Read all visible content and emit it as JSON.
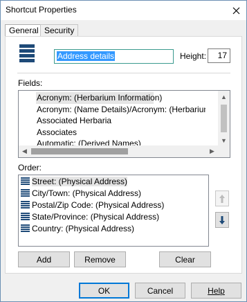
{
  "window": {
    "title": "Shortcut Properties"
  },
  "tabs": [
    {
      "label": "General"
    },
    {
      "label": "Security"
    }
  ],
  "general": {
    "name_value": "Address details",
    "height_label": "Height:",
    "height_value": "17"
  },
  "fields": {
    "label": "Fields:",
    "items": [
      "Acronym: (Herbarium Information)",
      "Acronym: (Name Details)/Acronym: (Herbarium In",
      "Associated Herbaria",
      "Associates",
      "Automatic: (Derived Names)"
    ]
  },
  "order": {
    "label": "Order:",
    "items": [
      "Street: (Physical Address)",
      "City/Town: (Physical Address)",
      "Postal/Zip Code: (Physical Address)",
      "State/Province: (Physical Address)",
      "Country: (Physical Address)"
    ]
  },
  "buttons": {
    "add": "Add",
    "remove": "Remove",
    "clear": "Clear",
    "ok": "OK",
    "cancel": "Cancel",
    "help": "Help"
  },
  "icons": {
    "close": "close-icon",
    "layer": "layer-stack-icon",
    "up": "arrow-up-icon",
    "down": "arrow-down-icon"
  },
  "colors": {
    "icon_blue": "#1e4a78",
    "selection": "#3399ff",
    "focus_border": "#0078d7"
  }
}
